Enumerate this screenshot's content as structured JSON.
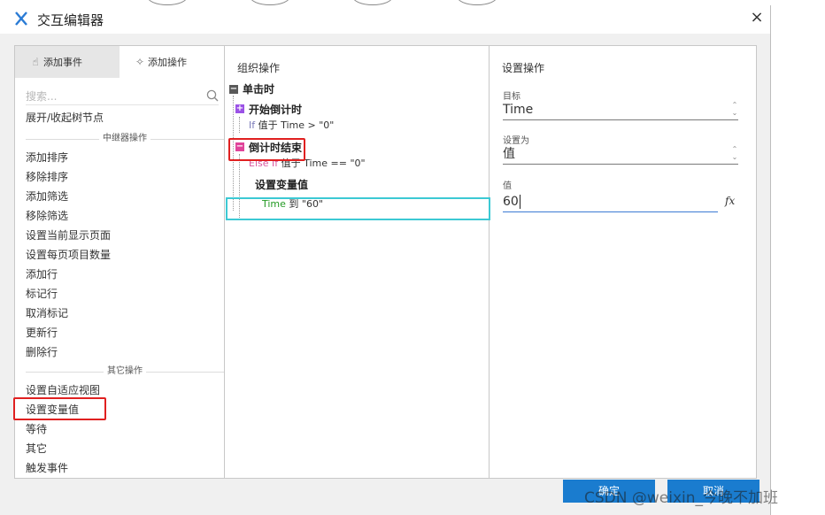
{
  "dialog": {
    "title": "交互编辑器",
    "close_glyph": "×"
  },
  "left_panel": {
    "tabs": [
      {
        "label": "添加事件",
        "icon": "pointer-icon"
      },
      {
        "label": "添加操作",
        "icon": "sparkle-icon"
      }
    ],
    "search_placeholder": "搜索...",
    "first_item": "展开/收起树节点",
    "sections": [
      {
        "label": "中继器操作",
        "items": [
          "添加排序",
          "移除排序",
          "添加筛选",
          "移除筛选",
          "设置当前显示页面",
          "设置每页项目数量",
          "添加行",
          "标记行",
          "取消标记",
          "更新行",
          "删除行"
        ]
      },
      {
        "label": "其它操作",
        "items": [
          "设置自适应视图",
          "设置变量值",
          "等待",
          "其它",
          "触发事件"
        ]
      }
    ]
  },
  "middle_panel": {
    "title": "组织操作",
    "event": "单击时",
    "case1": {
      "name": "开始倒计时",
      "cond_kw": "If",
      "cond_text": "值于 Time > \"0\""
    },
    "case2": {
      "name": "倒计时结束",
      "cond_kw": "Else If",
      "cond_text": "值于 Time == \"0\""
    },
    "action": {
      "name": "设置变量值",
      "var": "Time",
      "text": "到 \"60\""
    }
  },
  "right_panel": {
    "title": "设置操作",
    "target_label": "目标",
    "target_value": "Time",
    "setto_label": "设置为",
    "setto_value": "值",
    "value_label": "值",
    "value_value": "60",
    "fx": "fx"
  },
  "buttons": {
    "ok": "确定",
    "cancel": "取消"
  },
  "watermark": "CSDN @weixin_今晚不加班",
  "colors": {
    "primary": "#1a7ccf",
    "highlight_red": "#e02020",
    "highlight_cyan": "#3cc9d4",
    "plus_purple": "#9b52e6"
  }
}
